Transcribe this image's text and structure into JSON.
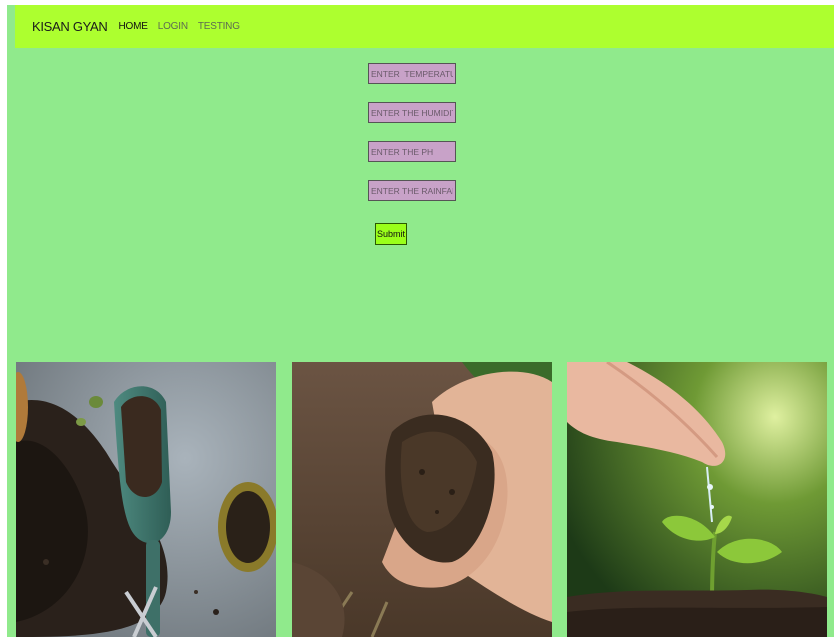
{
  "navbar": {
    "brand": "KISAN GYAN",
    "links": [
      "HOME",
      "LOGIN",
      "TESTING"
    ]
  },
  "form": {
    "temperature_placeholder": "ENTER  TEMPERATURE",
    "humidity_placeholder": "ENTER THE HUMIDITY",
    "ph_placeholder": "ENTER THE PH",
    "rainfall_placeholder": "ENTER THE RAINFALL",
    "submit_label": "Submit"
  },
  "colors": {
    "page_background": "#90ea8c",
    "navbar_background": "#adff2f",
    "input_background": "#c8a2c8",
    "submit_background": "#9aff1a"
  },
  "images": [
    "soil-scoop-photo",
    "hands-holding-soil-photo",
    "watering-seedling-photo"
  ]
}
